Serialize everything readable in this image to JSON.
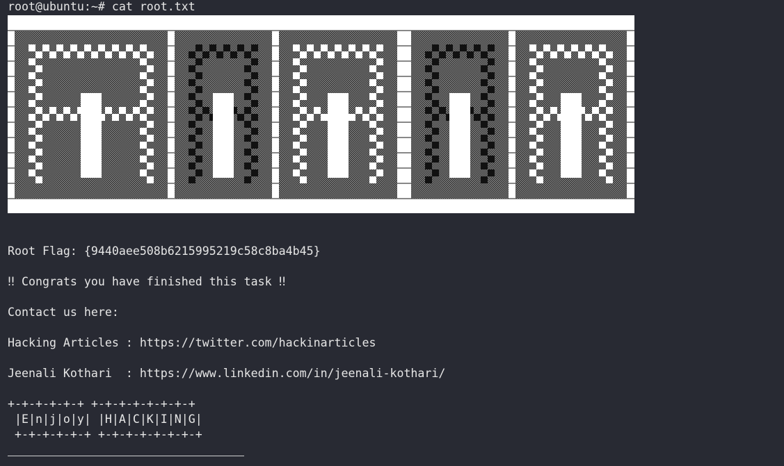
{
  "terminal": {
    "prompt_line": "root@ubuntu:~# cat root.txt",
    "banner_art": "ALFRIK",
    "lines": [
      "Root Flag: {9440aee508b6215995219c58c8ba4b45}",
      "‼ Congrats you have finished this task ‼",
      "Contact us here:",
      "Hacking Articles : https://twitter.com/hackinarticles",
      "Jeenali Kothari  : https://www.linkedin.com/in/jeenali-kothari/",
      "+-+-+-+-+-+ +-+-+-+-+-+-+-+",
      " |E|n|j|o|y| |H|A|C|K|I|N|G|",
      " +-+-+-+-+-+ +-+-+-+-+-+-+-+"
    ]
  },
  "colors": {
    "background": "#282a33",
    "text": "#e6e6e6",
    "banner_bg": "#ffffff",
    "banner_ink": "#111111"
  }
}
